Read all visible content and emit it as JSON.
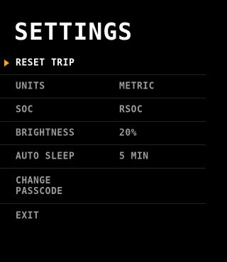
{
  "title": "SETTINGS",
  "colors": {
    "background": "#000000",
    "cursor": "#f5a623",
    "selected_text": "#ffffff",
    "text": "#9a9a9a",
    "divider": "#232323"
  },
  "menu": {
    "selected_index": 0,
    "items": [
      {
        "label": "RESET TRIP",
        "value": ""
      },
      {
        "label": "UNITS",
        "value": "METRIC"
      },
      {
        "label": "SOC",
        "value": "RSOC"
      },
      {
        "label": "BRIGHTNESS",
        "value": "20%"
      },
      {
        "label": "AUTO SLEEP",
        "value": "5 MIN"
      },
      {
        "label": "CHANGE\nPASSCODE",
        "value": ""
      },
      {
        "label": "EXIT",
        "value": ""
      }
    ]
  },
  "icons": {
    "cursor": "triangle-right-icon"
  }
}
